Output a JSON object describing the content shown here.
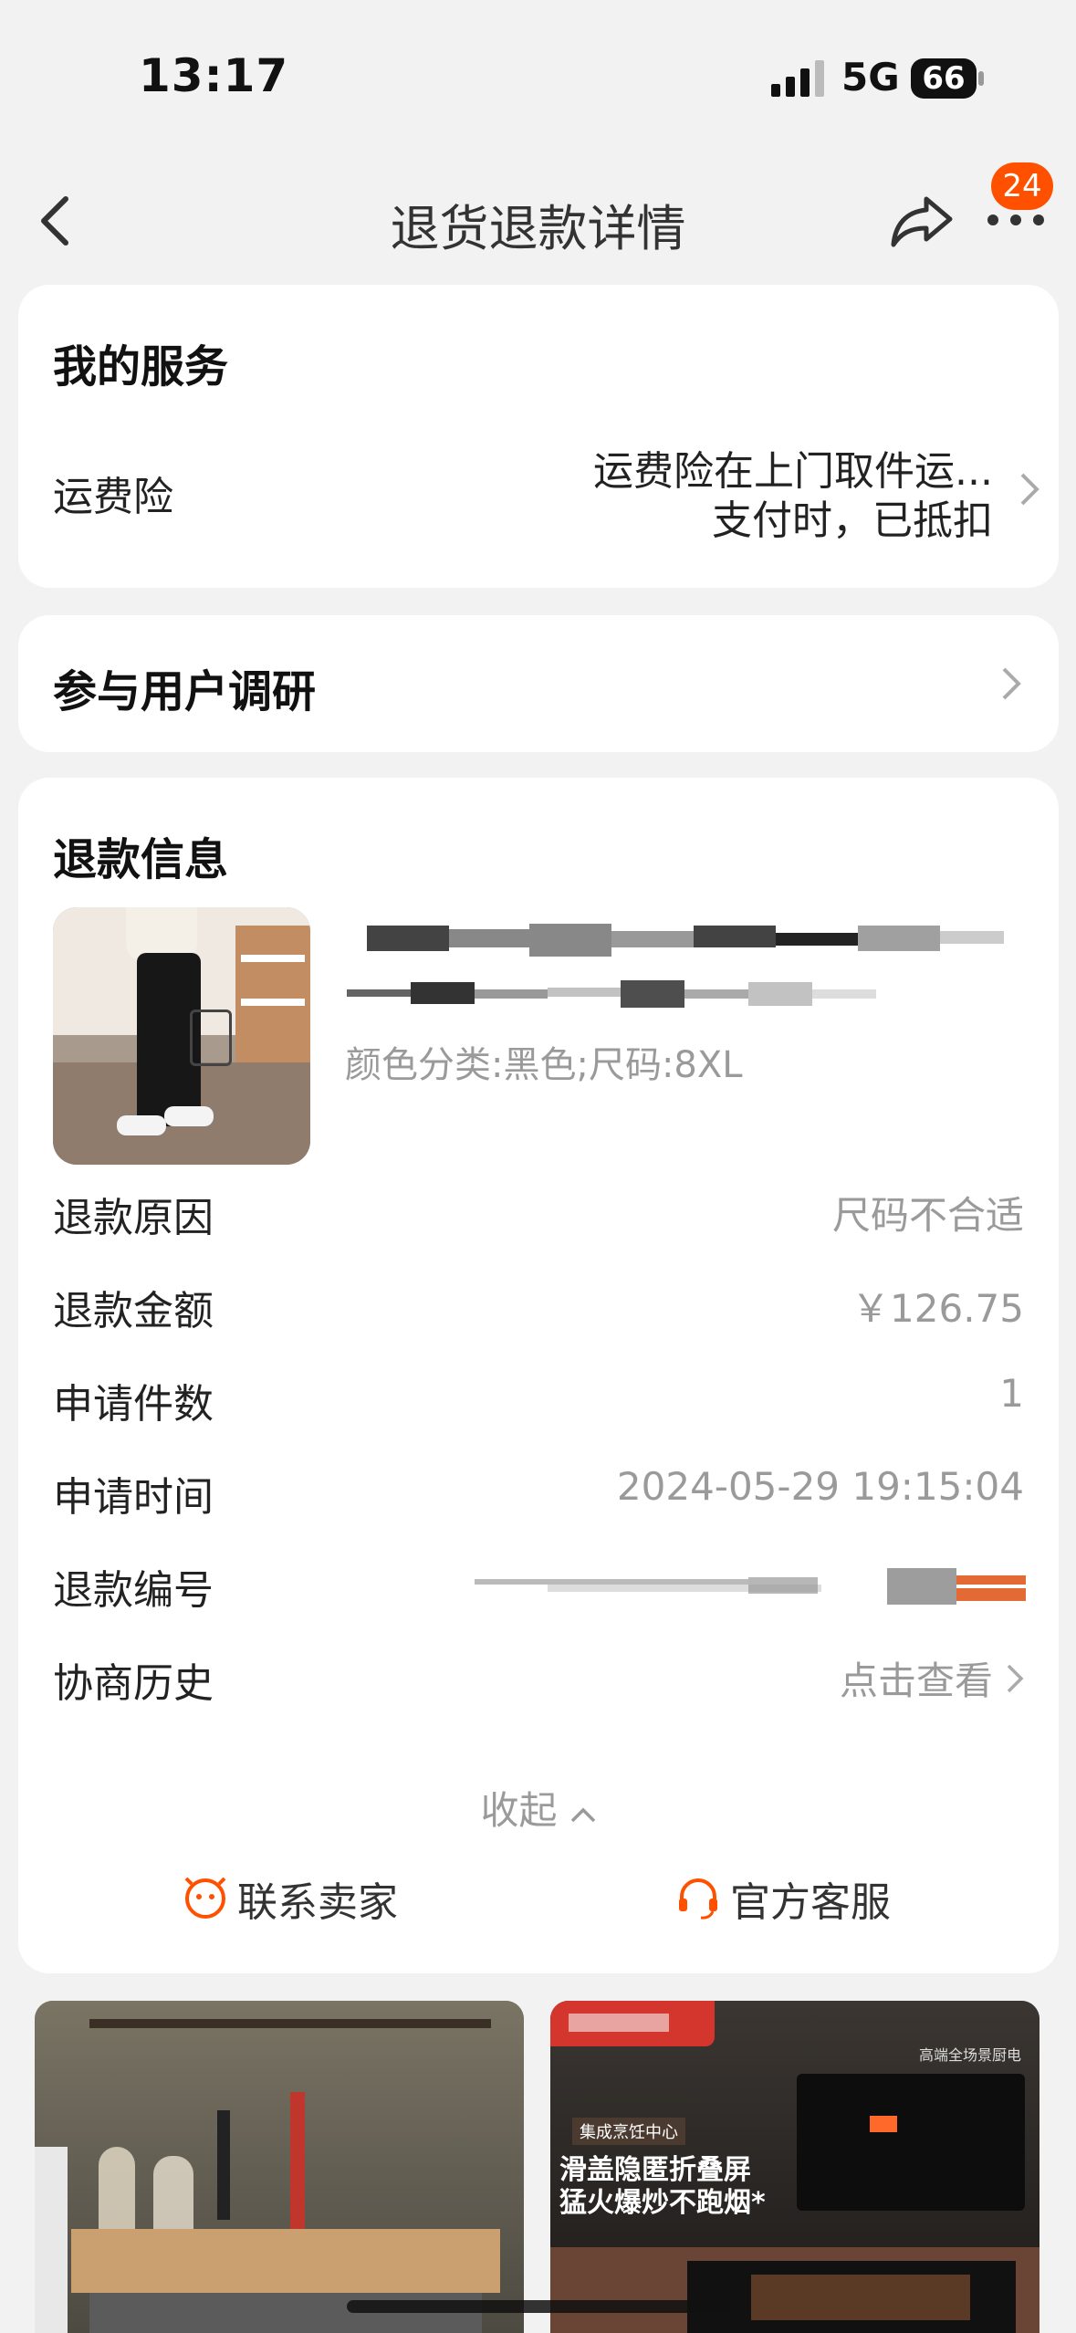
{
  "status_bar": {
    "time": "13:17",
    "network": "5G",
    "battery": "66"
  },
  "nav": {
    "title": "退货退款详情",
    "badge": "24"
  },
  "service": {
    "heading": "我的服务",
    "insurance_label": "运费险",
    "insurance_value_line1": "运费险在上门取件运...",
    "insurance_value_line2": "支付时，已抵扣"
  },
  "research": {
    "label": "参与用户调研"
  },
  "refund": {
    "heading": "退款信息",
    "product_spec": "颜色分类:黑色;尺码:8XL",
    "rows": [
      {
        "label": "退款原因",
        "value": "尺码不合适"
      },
      {
        "label": "退款金额",
        "value": "￥126.75"
      },
      {
        "label": "申请件数",
        "value": "1"
      },
      {
        "label": "申请时间",
        "value": "2024-05-29 19:15:04"
      },
      {
        "label": "退款编号",
        "value": ""
      },
      {
        "label": "协商历史",
        "value": "点击查看"
      }
    ],
    "collapse": "收起",
    "contact_seller": "联系卖家",
    "official_service": "官方客服"
  },
  "ads": {
    "right_tag": "集成烹饪中心",
    "right_line1": "滑盖隐匿折叠屏",
    "right_line2": "猛火爆炒不跑烟*",
    "right_top": "高端全场景厨电"
  },
  "colors": {
    "accent": "#ff5000",
    "muted": "#9a9a9a"
  }
}
